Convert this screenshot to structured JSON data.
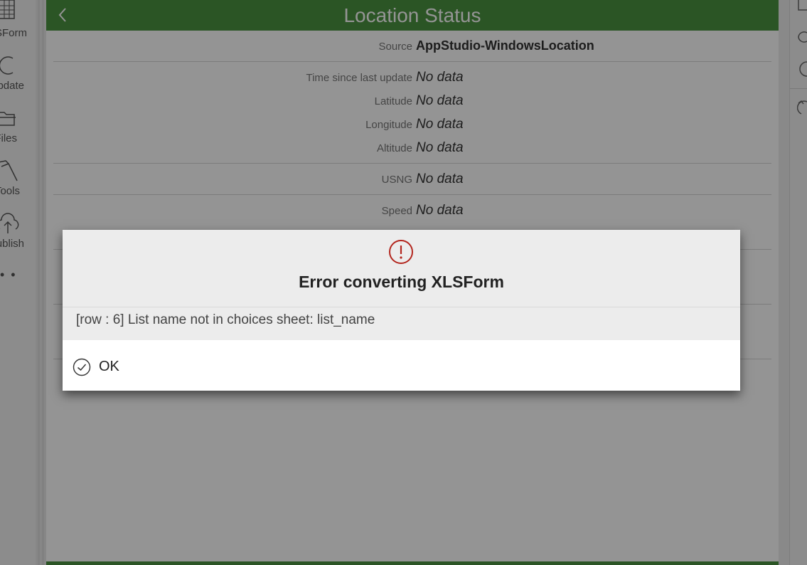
{
  "left_toolbar": {
    "items": [
      {
        "label": "XLSForm",
        "icon": "table-icon"
      },
      {
        "label": "Update",
        "icon": "refresh-icon"
      },
      {
        "label": "Files",
        "icon": "folder-icon"
      },
      {
        "label": "Tools",
        "icon": "hammer-icon"
      },
      {
        "label": "Publish",
        "icon": "cloud-upload-icon"
      }
    ],
    "more": "• •"
  },
  "header": {
    "title": "Location Status",
    "back_icon": "chevron-left-icon"
  },
  "location": {
    "source_label": "Source",
    "source_value": "AppStudio-WindowsLocation",
    "fields": [
      {
        "label": "Time since last update",
        "value": "No data"
      },
      {
        "label": "Latitude",
        "value": "No data"
      },
      {
        "label": "Longitude",
        "value": "No data"
      },
      {
        "label": "Altitude",
        "value": "No data"
      },
      {
        "label": "USNG",
        "value": "No data"
      },
      {
        "label": "Speed",
        "value": "No data"
      }
    ]
  },
  "dialog": {
    "icon": "exclamation-circle-icon",
    "title": "Error converting XLSForm",
    "message": "[row : 6] List name not in choices sheet: list_name",
    "ok_label": "OK",
    "ok_icon": "check-circle-icon"
  },
  "colors": {
    "header": "#4a9340",
    "error": "#b3261e",
    "overlay": "rgba(0,0,0,0.42)"
  }
}
